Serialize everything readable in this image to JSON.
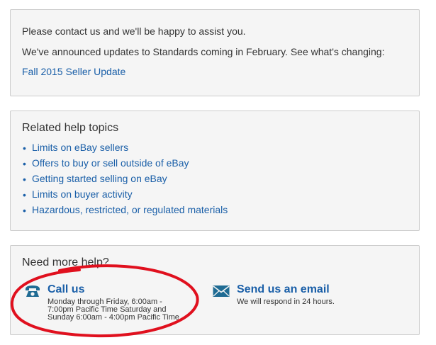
{
  "contact": {
    "line1": "Please contact us and we'll be happy to assist you.",
    "line2": "We've announced updates to Standards coming in February. See what's changing:",
    "link": "Fall 2015 Seller Update"
  },
  "related": {
    "heading": "Related help topics",
    "topics": [
      "Limits on eBay sellers",
      "Offers to buy or sell outside of eBay",
      "Getting started selling on eBay",
      "Limits on buyer activity",
      "Hazardous, restricted, or regulated materials"
    ]
  },
  "help": {
    "heading": "Need more help?",
    "call": {
      "title": "Call us",
      "desc_lines": [
        "Monday through Friday, 6:00am -",
        "7:00pm Pacific Time Saturday and",
        "Sunday 6:00am - 4:00pm Pacific Time."
      ]
    },
    "email": {
      "title": "Send us an email",
      "desc": "We will respond in 24 hours."
    }
  },
  "colors": {
    "link": "#1a5fa8",
    "panel_bg": "#f5f5f5",
    "annotation": "#e0101e"
  },
  "icons": {
    "call": "telephone-icon",
    "email": "envelope-icon"
  }
}
